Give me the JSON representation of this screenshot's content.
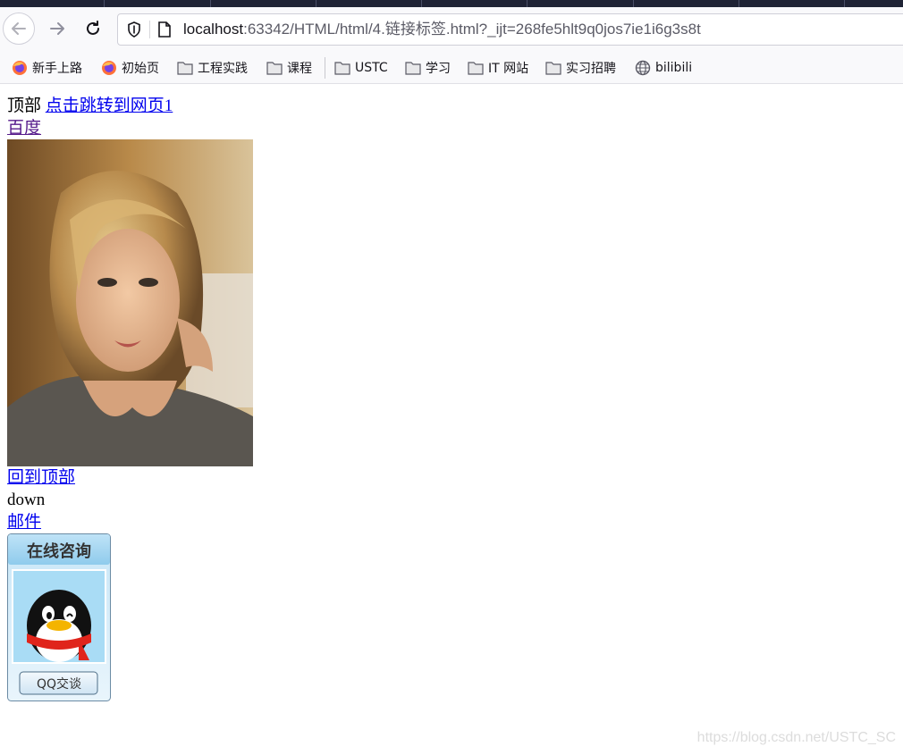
{
  "browser": {
    "url": {
      "host": "localhost",
      "rest": ":63342/HTML/html/4.链接标签.html?_ijt=268fe5hlt9q0jos7ie1i6g3s8t"
    },
    "bookmarks": [
      {
        "label": "新手上路",
        "icon": "firefox-icon"
      },
      {
        "label": "初始页",
        "icon": "firefox-icon"
      },
      {
        "label": "工程实践",
        "icon": "folder-icon"
      },
      {
        "label": "课程",
        "icon": "folder-icon"
      },
      {
        "label": "USTC",
        "icon": "folder-icon"
      },
      {
        "label": "学习",
        "icon": "folder-icon"
      },
      {
        "label": "IT 网站",
        "icon": "folder-icon"
      },
      {
        "label": "实习招聘",
        "icon": "folder-icon"
      },
      {
        "label": "bilibili",
        "icon": "globe-icon"
      }
    ]
  },
  "page": {
    "top_text": "顶部",
    "jump_link": "点击跳转到网页1",
    "baidu_link": "百度",
    "back_to_top_link": "回到顶部",
    "down_text": "down",
    "mail_link": "邮件",
    "qq_widget": {
      "header": "在线咨询",
      "button": "QQ交谈"
    }
  },
  "watermark": "https://blog.csdn.net/USTC_SC",
  "colors": {
    "link": "#0000ee",
    "visited_link": "#551a8b",
    "tab_strip": "#1f2335"
  }
}
